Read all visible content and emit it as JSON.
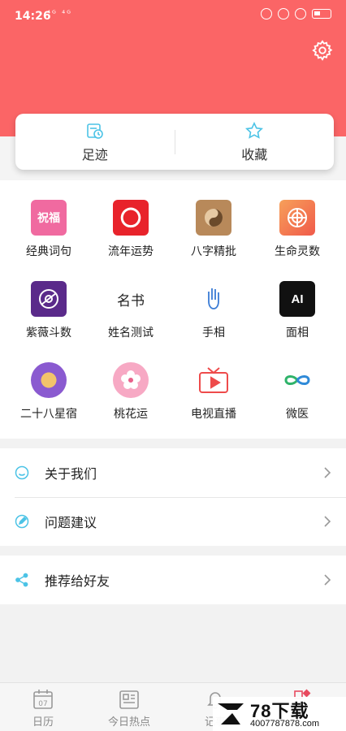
{
  "status_bar": {
    "time": "14:26",
    "left_icons": "⁴ᴳ ⁴ᴳ",
    "network_badge": "NFC"
  },
  "header": {
    "settings_icon": "gear-icon"
  },
  "quick_card": [
    {
      "label": "足迹",
      "icon": "footprint-calendar-icon"
    },
    {
      "label": "收藏",
      "icon": "star-icon"
    }
  ],
  "tools": [
    {
      "label": "经典词句",
      "icon_text": "祝福"
    },
    {
      "label": "流年运势",
      "icon_text": ""
    },
    {
      "label": "八字精批",
      "icon_text": ""
    },
    {
      "label": "生命灵数",
      "icon_text": ""
    },
    {
      "label": "紫薇斗数",
      "icon_text": ""
    },
    {
      "label": "姓名测试",
      "icon_text": "名书"
    },
    {
      "label": "手相",
      "icon_text": ""
    },
    {
      "label": "面相",
      "icon_text": "AI"
    },
    {
      "label": "二十八星宿",
      "icon_text": ""
    },
    {
      "label": "桃花运",
      "icon_text": ""
    },
    {
      "label": "电视直播",
      "icon_text": ""
    },
    {
      "label": "微医",
      "icon_text": ""
    }
  ],
  "menu": [
    {
      "label": "关于我们",
      "icon": "smile-icon"
    },
    {
      "label": "问题建议",
      "icon": "pen-icon"
    },
    {
      "label": "推荐给好友",
      "icon": "share-icon"
    }
  ],
  "tabbar": [
    {
      "label": "日历",
      "icon_text": "07"
    },
    {
      "label": "今日热点",
      "icon_text": ""
    },
    {
      "label": "记事",
      "icon_text": ""
    }
  ],
  "watermark": {
    "big": "78下载",
    "small": "4007787878.com"
  },
  "colors": {
    "header": "#fb6566",
    "accent": "#4cc3e6"
  }
}
